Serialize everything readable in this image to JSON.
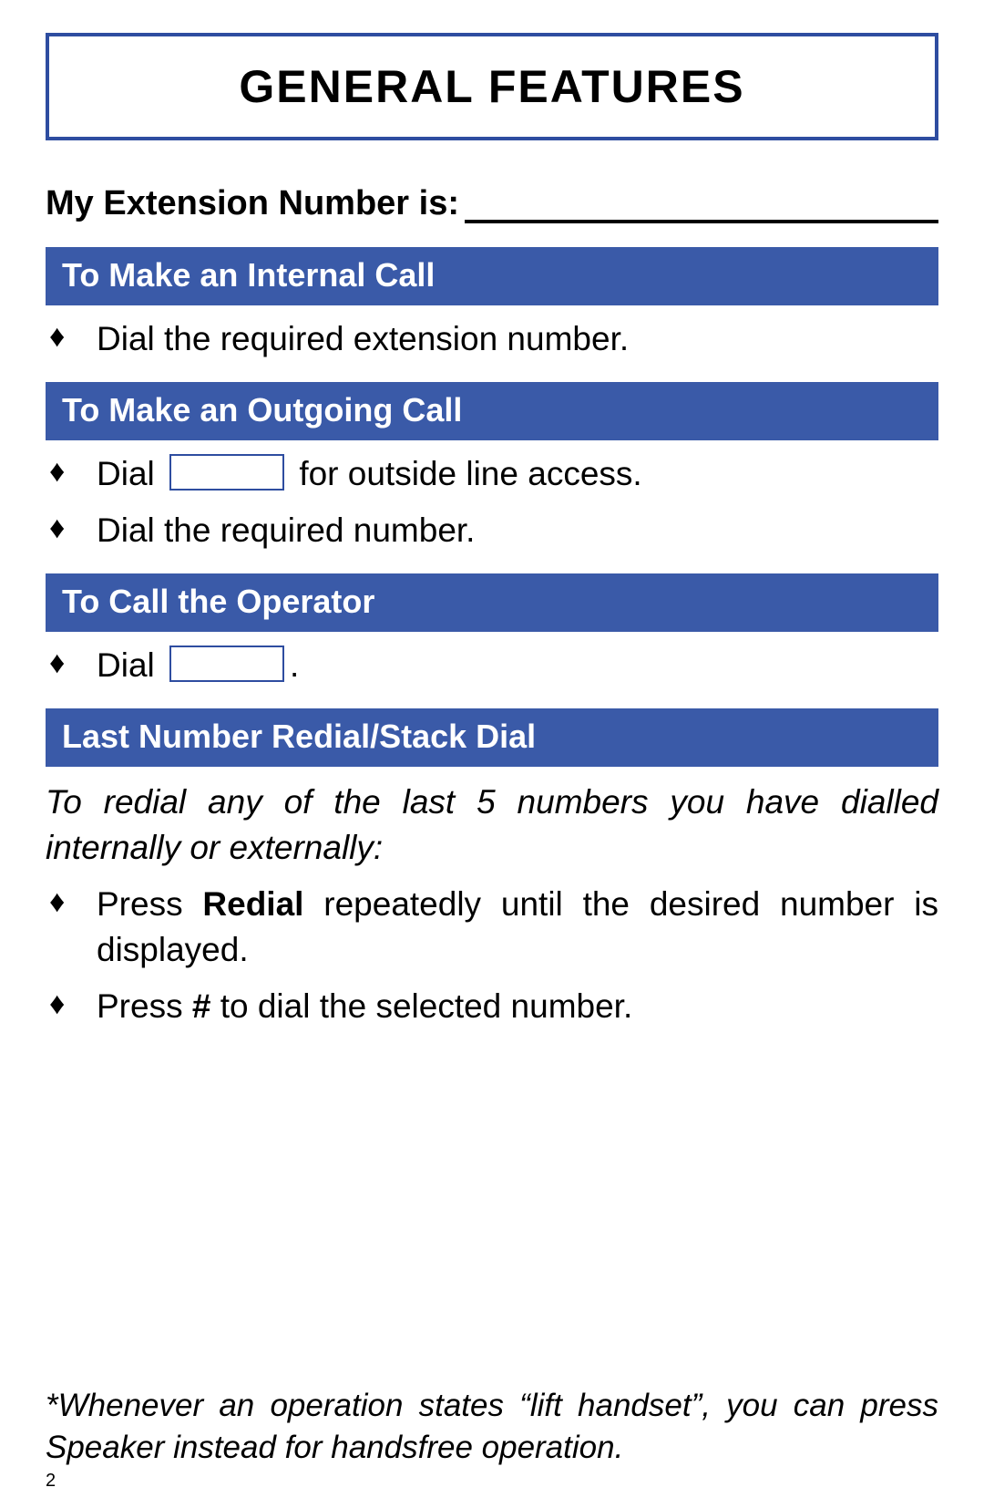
{
  "title": "GENERAL FEATURES",
  "extension_label": "My Extension Number is:",
  "sections": {
    "internal": {
      "header": "To Make an Internal Call",
      "b1": "Dial the required extension number."
    },
    "outgoing": {
      "header": "To Make an Outgoing Call",
      "b1_pre": "Dial",
      "b1_post": "for outside line access.",
      "b2": "Dial the required number."
    },
    "operator": {
      "header": "To Call the Operator",
      "b1_pre": "Dial",
      "b1_post": "."
    },
    "redial": {
      "header": "Last Number Redial/Stack Dial",
      "lead": "To redial any of the last 5 numbers you have dialled internally or externally:",
      "b1_pre": "Press ",
      "b1_bold": "Redial",
      "b1_post": " repeatedly until the desired number is displayed.",
      "b2_pre": "Press ",
      "b2_bold": "#",
      "b2_post": " to dial the selected number."
    }
  },
  "footnote": "*Whenever an operation states “lift handset”, you can press Speaker instead for handsfree operation.",
  "page_number": "2",
  "bullet_glyph": "♦"
}
